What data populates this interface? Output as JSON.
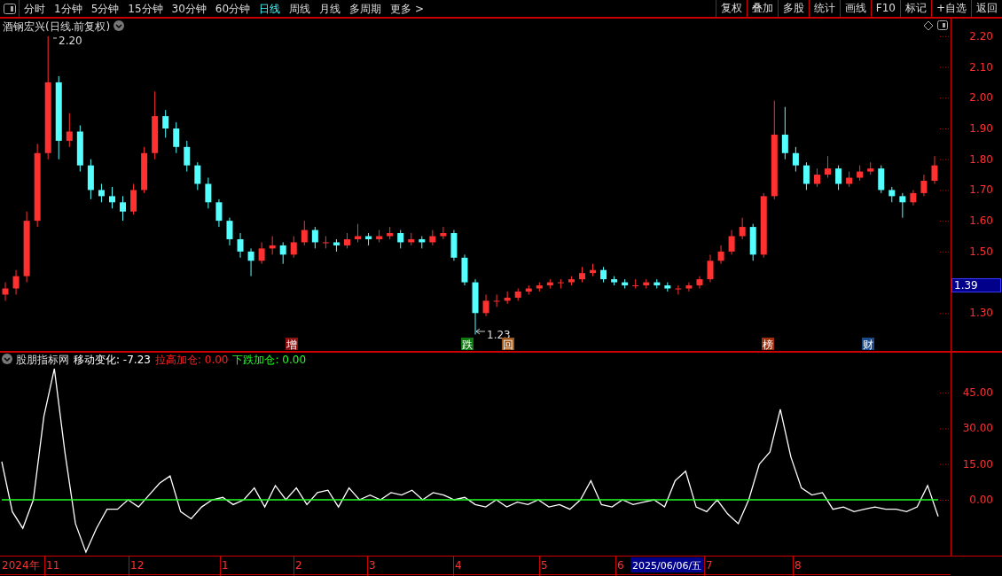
{
  "toolbar": {
    "periods": [
      {
        "label": "分时",
        "selected": false
      },
      {
        "label": "1分钟",
        "selected": false
      },
      {
        "label": "5分钟",
        "selected": false
      },
      {
        "label": "15分钟",
        "selected": false
      },
      {
        "label": "30分钟",
        "selected": false
      },
      {
        "label": "60分钟",
        "selected": false
      },
      {
        "label": "日线",
        "selected": true
      },
      {
        "label": "周线",
        "selected": false
      },
      {
        "label": "月线",
        "selected": false
      },
      {
        "label": "多周期",
        "selected": false
      },
      {
        "label": "更多 >",
        "selected": false
      }
    ],
    "actions": [
      "复权",
      "叠加",
      "多股",
      "统计",
      "画线",
      "F10",
      "标记",
      "+自选",
      "返回"
    ]
  },
  "price_chart": {
    "title": "酒钢宏兴(日线.前复权)",
    "current_price": "1.39",
    "high_marker": "2.20",
    "low_marker": "1.23",
    "events": [
      {
        "label": "增",
        "color": "#8b1010"
      },
      {
        "label": "跌",
        "color": "#107a10"
      },
      {
        "label": "回",
        "color": "#a0581a"
      },
      {
        "label": "榜",
        "color": "#a0300c"
      },
      {
        "label": "财",
        "color": "#1a4a8a"
      }
    ],
    "chart_data": {
      "type": "candlestick",
      "ylim": [
        1.177,
        2.26
      ],
      "categories": [
        null,
        null,
        null,
        null,
        null,
        null,
        null,
        null,
        null,
        null,
        null,
        null,
        null,
        null,
        null,
        null,
        null,
        null,
        null,
        null,
        null,
        null,
        null,
        null,
        null,
        null,
        null,
        null,
        null,
        null,
        null,
        null,
        null,
        null,
        null,
        null,
        null,
        null,
        null,
        null,
        null,
        null,
        null,
        null,
        null,
        null,
        null,
        null,
        null,
        null,
        null,
        null,
        null,
        null,
        null,
        null,
        null,
        null,
        null,
        null,
        null,
        null,
        null,
        null,
        null,
        null,
        null,
        null,
        null,
        null,
        null,
        null,
        null,
        null,
        null,
        null,
        null,
        null,
        null,
        null,
        null,
        null,
        null,
        null,
        null,
        null,
        null,
        null
      ],
      "yticks": [
        {
          "value": 2.2,
          "label": "2.20"
        },
        {
          "value": 2.1,
          "label": "2.10"
        },
        {
          "value": 2.0,
          "label": "2.00"
        },
        {
          "value": 1.9,
          "label": "1.90"
        },
        {
          "value": 1.8,
          "label": "1.80"
        },
        {
          "value": 1.7,
          "label": "1.70"
        },
        {
          "value": 1.6,
          "label": "1.60"
        },
        {
          "value": 1.5,
          "label": "1.50"
        },
        {
          "value": 1.3,
          "label": "1.30"
        }
      ],
      "ohlc": [
        [
          1.36,
          1.4,
          1.34,
          1.38
        ],
        [
          1.38,
          1.44,
          1.36,
          1.42
        ],
        [
          1.42,
          1.63,
          1.4,
          1.6
        ],
        [
          1.6,
          1.85,
          1.58,
          1.82
        ],
        [
          1.82,
          2.2,
          1.8,
          2.05
        ],
        [
          2.05,
          2.07,
          1.8,
          1.86
        ],
        [
          1.86,
          1.95,
          1.84,
          1.89
        ],
        [
          1.89,
          1.91,
          1.76,
          1.78
        ],
        [
          1.78,
          1.8,
          1.67,
          1.7
        ],
        [
          1.7,
          1.72,
          1.66,
          1.68
        ],
        [
          1.68,
          1.71,
          1.64,
          1.66
        ],
        [
          1.66,
          1.68,
          1.6,
          1.63
        ],
        [
          1.63,
          1.72,
          1.62,
          1.7
        ],
        [
          1.7,
          1.84,
          1.69,
          1.82
        ],
        [
          1.82,
          2.02,
          1.8,
          1.94
        ],
        [
          1.94,
          1.96,
          1.87,
          1.9
        ],
        [
          1.9,
          1.92,
          1.82,
          1.84
        ],
        [
          1.84,
          1.86,
          1.76,
          1.78
        ],
        [
          1.78,
          1.79,
          1.7,
          1.72
        ],
        [
          1.72,
          1.74,
          1.64,
          1.66
        ],
        [
          1.66,
          1.67,
          1.58,
          1.6
        ],
        [
          1.6,
          1.61,
          1.52,
          1.54
        ],
        [
          1.54,
          1.56,
          1.48,
          1.5
        ],
        [
          1.5,
          1.51,
          1.42,
          1.47
        ],
        [
          1.47,
          1.53,
          1.46,
          1.51
        ],
        [
          1.51,
          1.55,
          1.49,
          1.52
        ],
        [
          1.52,
          1.53,
          1.46,
          1.49
        ],
        [
          1.49,
          1.55,
          1.48,
          1.53
        ],
        [
          1.53,
          1.6,
          1.52,
          1.57
        ],
        [
          1.57,
          1.58,
          1.51,
          1.53
        ],
        [
          1.53,
          1.55,
          1.51,
          1.53
        ],
        [
          1.53,
          1.54,
          1.5,
          1.52
        ],
        [
          1.52,
          1.56,
          1.51,
          1.54
        ],
        [
          1.54,
          1.59,
          1.53,
          1.55
        ],
        [
          1.55,
          1.56,
          1.52,
          1.54
        ],
        [
          1.54,
          1.57,
          1.53,
          1.55
        ],
        [
          1.55,
          1.58,
          1.54,
          1.56
        ],
        [
          1.56,
          1.57,
          1.51,
          1.53
        ],
        [
          1.53,
          1.56,
          1.52,
          1.54
        ],
        [
          1.54,
          1.55,
          1.51,
          1.53
        ],
        [
          1.53,
          1.57,
          1.52,
          1.55
        ],
        [
          1.55,
          1.58,
          1.54,
          1.56
        ],
        [
          1.56,
          1.57,
          1.47,
          1.48
        ],
        [
          1.48,
          1.49,
          1.39,
          1.4
        ],
        [
          1.4,
          1.41,
          1.23,
          1.3
        ],
        [
          1.3,
          1.36,
          1.29,
          1.34
        ],
        [
          1.34,
          1.36,
          1.32,
          1.34
        ],
        [
          1.34,
          1.37,
          1.33,
          1.35
        ],
        [
          1.35,
          1.38,
          1.34,
          1.37
        ],
        [
          1.37,
          1.39,
          1.36,
          1.38
        ],
        [
          1.38,
          1.4,
          1.37,
          1.39
        ],
        [
          1.39,
          1.41,
          1.38,
          1.4
        ],
        [
          1.4,
          1.41,
          1.38,
          1.4
        ],
        [
          1.4,
          1.42,
          1.39,
          1.41
        ],
        [
          1.41,
          1.45,
          1.4,
          1.43
        ],
        [
          1.43,
          1.46,
          1.42,
          1.44
        ],
        [
          1.44,
          1.45,
          1.4,
          1.41
        ],
        [
          1.41,
          1.42,
          1.39,
          1.4
        ],
        [
          1.4,
          1.41,
          1.38,
          1.39
        ],
        [
          1.39,
          1.41,
          1.38,
          1.39
        ],
        [
          1.39,
          1.41,
          1.38,
          1.4
        ],
        [
          1.4,
          1.41,
          1.38,
          1.39
        ],
        [
          1.39,
          1.4,
          1.37,
          1.38
        ],
        [
          1.38,
          1.39,
          1.36,
          1.38
        ],
        [
          1.38,
          1.4,
          1.37,
          1.39
        ],
        [
          1.39,
          1.42,
          1.38,
          1.41
        ],
        [
          1.41,
          1.49,
          1.4,
          1.47
        ],
        [
          1.47,
          1.52,
          1.46,
          1.5
        ],
        [
          1.5,
          1.57,
          1.49,
          1.55
        ],
        [
          1.55,
          1.61,
          1.54,
          1.58
        ],
        [
          1.58,
          1.59,
          1.47,
          1.49
        ],
        [
          1.49,
          1.69,
          1.48,
          1.68
        ],
        [
          1.68,
          1.99,
          1.67,
          1.88
        ],
        [
          1.88,
          1.97,
          1.8,
          1.82
        ],
        [
          1.82,
          1.84,
          1.76,
          1.78
        ],
        [
          1.78,
          1.79,
          1.7,
          1.72
        ],
        [
          1.72,
          1.77,
          1.71,
          1.75
        ],
        [
          1.75,
          1.81,
          1.74,
          1.77
        ],
        [
          1.77,
          1.78,
          1.7,
          1.72
        ],
        [
          1.72,
          1.76,
          1.71,
          1.74
        ],
        [
          1.74,
          1.78,
          1.73,
          1.76
        ],
        [
          1.76,
          1.79,
          1.75,
          1.77
        ],
        [
          1.77,
          1.78,
          1.69,
          1.7
        ],
        [
          1.7,
          1.71,
          1.66,
          1.68
        ],
        [
          1.68,
          1.69,
          1.61,
          1.66
        ],
        [
          1.66,
          1.7,
          1.65,
          1.69
        ],
        [
          1.69,
          1.75,
          1.68,
          1.73
        ],
        [
          1.73,
          1.81,
          1.72,
          1.78
        ]
      ]
    }
  },
  "indicator": {
    "name": "股朋指标网",
    "readings": [
      {
        "label": "移动变化: -7.23",
        "color": "#ffffff"
      },
      {
        "label": "拉高加仓: 0.00",
        "color": "#ff2020"
      },
      {
        "label": "下跌加仓: 0.00",
        "color": "#20ff20"
      }
    ],
    "chart_data": {
      "type": "line",
      "ylim": [
        -23.45,
        62.15
      ],
      "yticks": [
        {
          "value": 45,
          "label": "45.00"
        },
        {
          "value": 30,
          "label": "30.00"
        },
        {
          "value": 15,
          "label": "15.00"
        },
        {
          "value": 0,
          "label": "0.00"
        }
      ],
      "series": [
        {
          "color": "#ffffff",
          "values": [
            16,
            -5,
            -12,
            0,
            35,
            55,
            20,
            -10,
            -22,
            -12,
            -4,
            -4,
            0,
            -3,
            2,
            7,
            10,
            -5,
            -8,
            -3,
            0,
            1,
            -2,
            0,
            5,
            -3,
            6,
            0,
            5,
            -2,
            3,
            4,
            -3,
            5,
            0,
            2,
            0,
            3,
            2,
            4,
            0,
            3,
            2,
            0,
            1,
            -2,
            -3,
            0,
            -3,
            -1,
            -2,
            0,
            -3,
            -2,
            -4,
            0,
            8,
            -2,
            -3,
            0,
            -2,
            -1,
            0,
            -3,
            8,
            12,
            -3,
            -5,
            0,
            -6,
            -10,
            0,
            15,
            20,
            38,
            18,
            5,
            2,
            3,
            -4,
            -3,
            -5,
            -4,
            -3,
            -4,
            -4,
            -5,
            -3,
            6,
            -7
          ]
        },
        {
          "color": "#20ff20",
          "values": [
            0,
            0,
            0,
            0,
            0,
            0,
            0,
            0,
            0,
            0,
            0,
            0,
            0,
            0,
            0,
            0,
            0,
            0,
            0,
            0,
            0,
            0,
            0,
            0,
            0,
            0,
            0,
            0,
            0,
            0,
            0,
            0,
            0,
            0,
            0,
            0,
            0,
            0,
            0,
            0,
            0,
            0,
            0,
            0,
            0,
            0,
            0,
            0,
            0,
            0,
            0,
            0,
            0,
            0,
            0,
            0,
            0,
            0,
            0,
            0,
            0,
            0,
            0,
            0,
            0,
            0,
            0,
            0,
            0,
            0,
            0,
            0,
            0,
            0,
            0,
            0,
            0,
            0,
            0,
            0,
            0,
            0,
            0,
            0,
            0,
            0,
            0,
            0,
            0,
            0
          ]
        }
      ]
    }
  },
  "date_axis": {
    "labels": [
      "2024年",
      "11",
      "12",
      "1",
      "2",
      "3",
      "4",
      "5",
      "6",
      "7",
      "8"
    ],
    "cursor_date": "2025/06/06/五"
  }
}
